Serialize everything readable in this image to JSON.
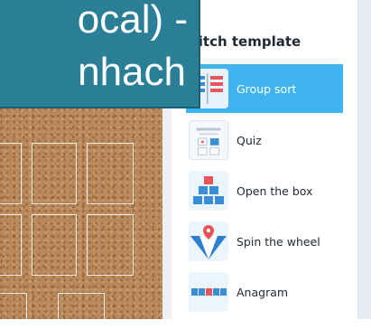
{
  "overlay": {
    "line1": "ocal) -",
    "line2": "nhach"
  },
  "panel": {
    "title": "vitch template",
    "items": [
      {
        "label": "Group sort",
        "icon": "group-sort-icon",
        "selected": true
      },
      {
        "label": "Quiz",
        "icon": "quiz-icon",
        "selected": false
      },
      {
        "label": "Open the box",
        "icon": "open-the-box-icon",
        "selected": false
      },
      {
        "label": "Spin the wheel",
        "icon": "spin-the-wheel-icon",
        "selected": false
      },
      {
        "label": "Anagram",
        "icon": "anagram-icon",
        "selected": false
      }
    ]
  },
  "colors": {
    "selected": "#40b4f0",
    "overlay": "#2a7f97",
    "cork": "#b8875a"
  }
}
